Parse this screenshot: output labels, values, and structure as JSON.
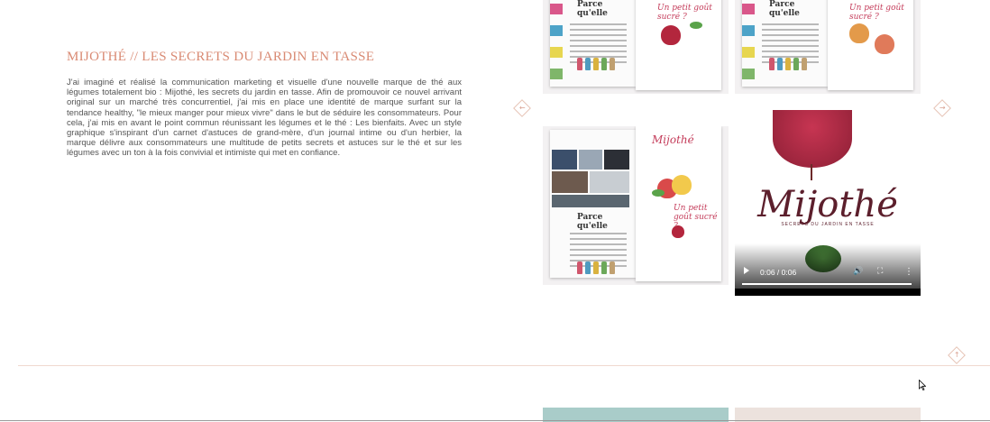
{
  "project": {
    "title": "MIJOTHÉ // LES SECRETS DU JARDIN EN TASSE",
    "description": "J'ai imaginé et réalisé la communication marketing et visuelle d'une nouvelle marque de thé aux légumes totalement bio : Mijothé, les secrets du jardin en tasse. Afin de promouvoir ce nouvel arrivant original sur un marché très concurrentiel, j'ai mis en place une identité de marque surfant sur la tendance healthy, \"le mieux manger pour mieux vivre\" dans le but de séduire les consommateurs. Pour cela, j'ai mis en avant le point commun réunissant les légumes et le thé : Les bienfaits. Avec un style graphique s'inspirant d'un carnet d'astuces de grand-mère, d'un journal intime ou d'un herbier, la marque délivre aux consommateurs une multitude de petits secrets et astuces sur le thé et sur les légumes avec un ton à la fois convivial et intimiste qui met en confiance."
  },
  "gallery": {
    "prev_icon": "←",
    "next_icon": "→",
    "scroll_top_icon": "↑",
    "magazine_brand": "Parce qu'elle",
    "magazine_script_1": "Mijothé",
    "magazine_script_2": "Un petit goût sucré ?",
    "video": {
      "logo": "Mijothé",
      "tagline": "SECRETS DU JARDIN EN TASSE",
      "time": "0:06 / 0:06",
      "volume_icon": "🔊",
      "fullscreen_icon": "⛶",
      "menu_icon": "⋮"
    }
  },
  "colors": {
    "accent": "#d98a73",
    "divider": "#f0d9cf"
  }
}
